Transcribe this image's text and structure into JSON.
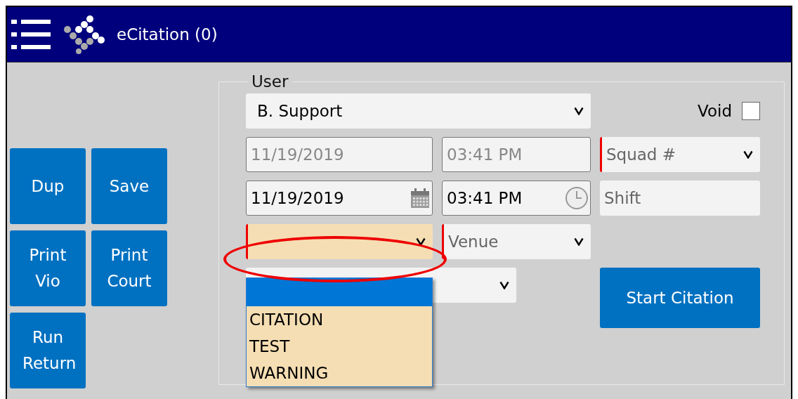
{
  "window": {
    "title": "eCitation (0)"
  },
  "side_buttons": [
    "Dup",
    "Save",
    "Print Vio",
    "Print Court",
    "Run Return"
  ],
  "group": {
    "legend": "User"
  },
  "user_select": {
    "value": "B. Support"
  },
  "void": {
    "label": "Void",
    "checked": false
  },
  "issued": {
    "date": "11/19/2019",
    "time": "03:41 PM",
    "disabled": true
  },
  "squad": {
    "placeholder": "Squad #",
    "required": true
  },
  "occurred": {
    "date": "11/19/2019",
    "time": "03:41 PM",
    "disabled": false
  },
  "shift": {
    "placeholder": "Shift"
  },
  "type_select": {
    "required": true,
    "expanded": true,
    "options": [
      {
        "selected": true
      },
      {
        "label": "CITATION",
        "selected": false
      },
      {
        "label": "TEST",
        "selected": false
      },
      {
        "label": "WARNING",
        "selected": false
      }
    ]
  },
  "venue": {
    "placeholder": "Venue",
    "required": true
  },
  "start_button": "Start Citation",
  "annotation": {
    "kind": "ellipse"
  }
}
